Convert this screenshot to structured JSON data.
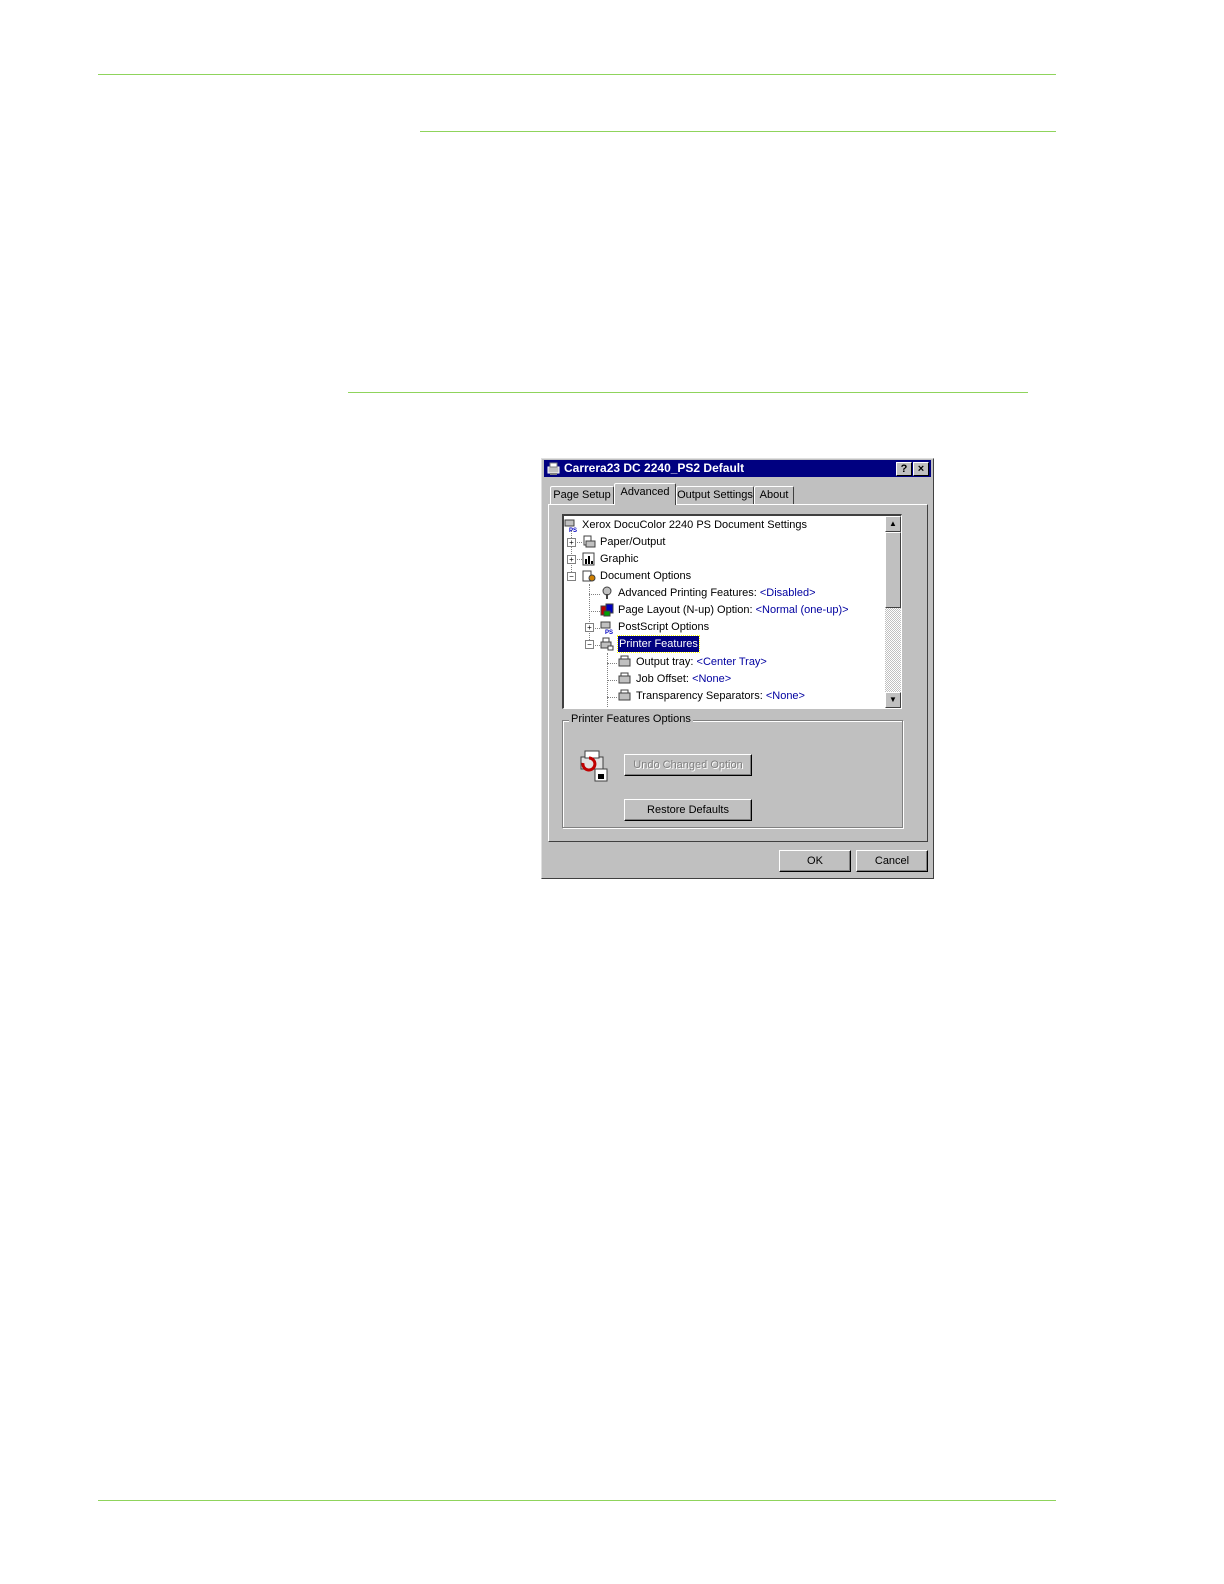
{
  "dialog": {
    "title": "Carrera23 DC 2240_PS2 Default",
    "help_button": "?",
    "close_button": "×",
    "tabs": [
      {
        "label": "Page Setup",
        "active": false
      },
      {
        "label": "Advanced",
        "active": true
      },
      {
        "label": "Output Settings",
        "active": false
      },
      {
        "label": "About",
        "active": false
      }
    ],
    "tree": {
      "root": "Xerox DocuColor 2240 PS Document Settings",
      "paper_output": "Paper/Output",
      "graphic": "Graphic",
      "document_options": "Document Options",
      "advanced_printing": {
        "label": "Advanced Printing Features:",
        "value": "<Disabled>"
      },
      "page_layout": {
        "label": "Page Layout (N-up) Option:",
        "value": "<Normal (one-up)>"
      },
      "postscript_options": "PostScript Options",
      "printer_features": "Printer Features",
      "output_tray": {
        "label": "Output tray:",
        "value": "<Center Tray>"
      },
      "job_offset": {
        "label": "Job Offset:",
        "value": "<None>"
      },
      "transparency_separators": {
        "label": "Transparency Separators:",
        "value": "<None>"
      }
    },
    "options_group": {
      "legend": "Printer Features Options",
      "undo_button": "Undo Changed Option",
      "restore_button": "Restore Defaults"
    },
    "ok_button": "OK",
    "cancel_button": "Cancel"
  },
  "colors": {
    "rule": "#8fd45c",
    "titlebar": "#000080",
    "dialog_face": "#c0c0c0",
    "value_text": "#0000a0"
  }
}
